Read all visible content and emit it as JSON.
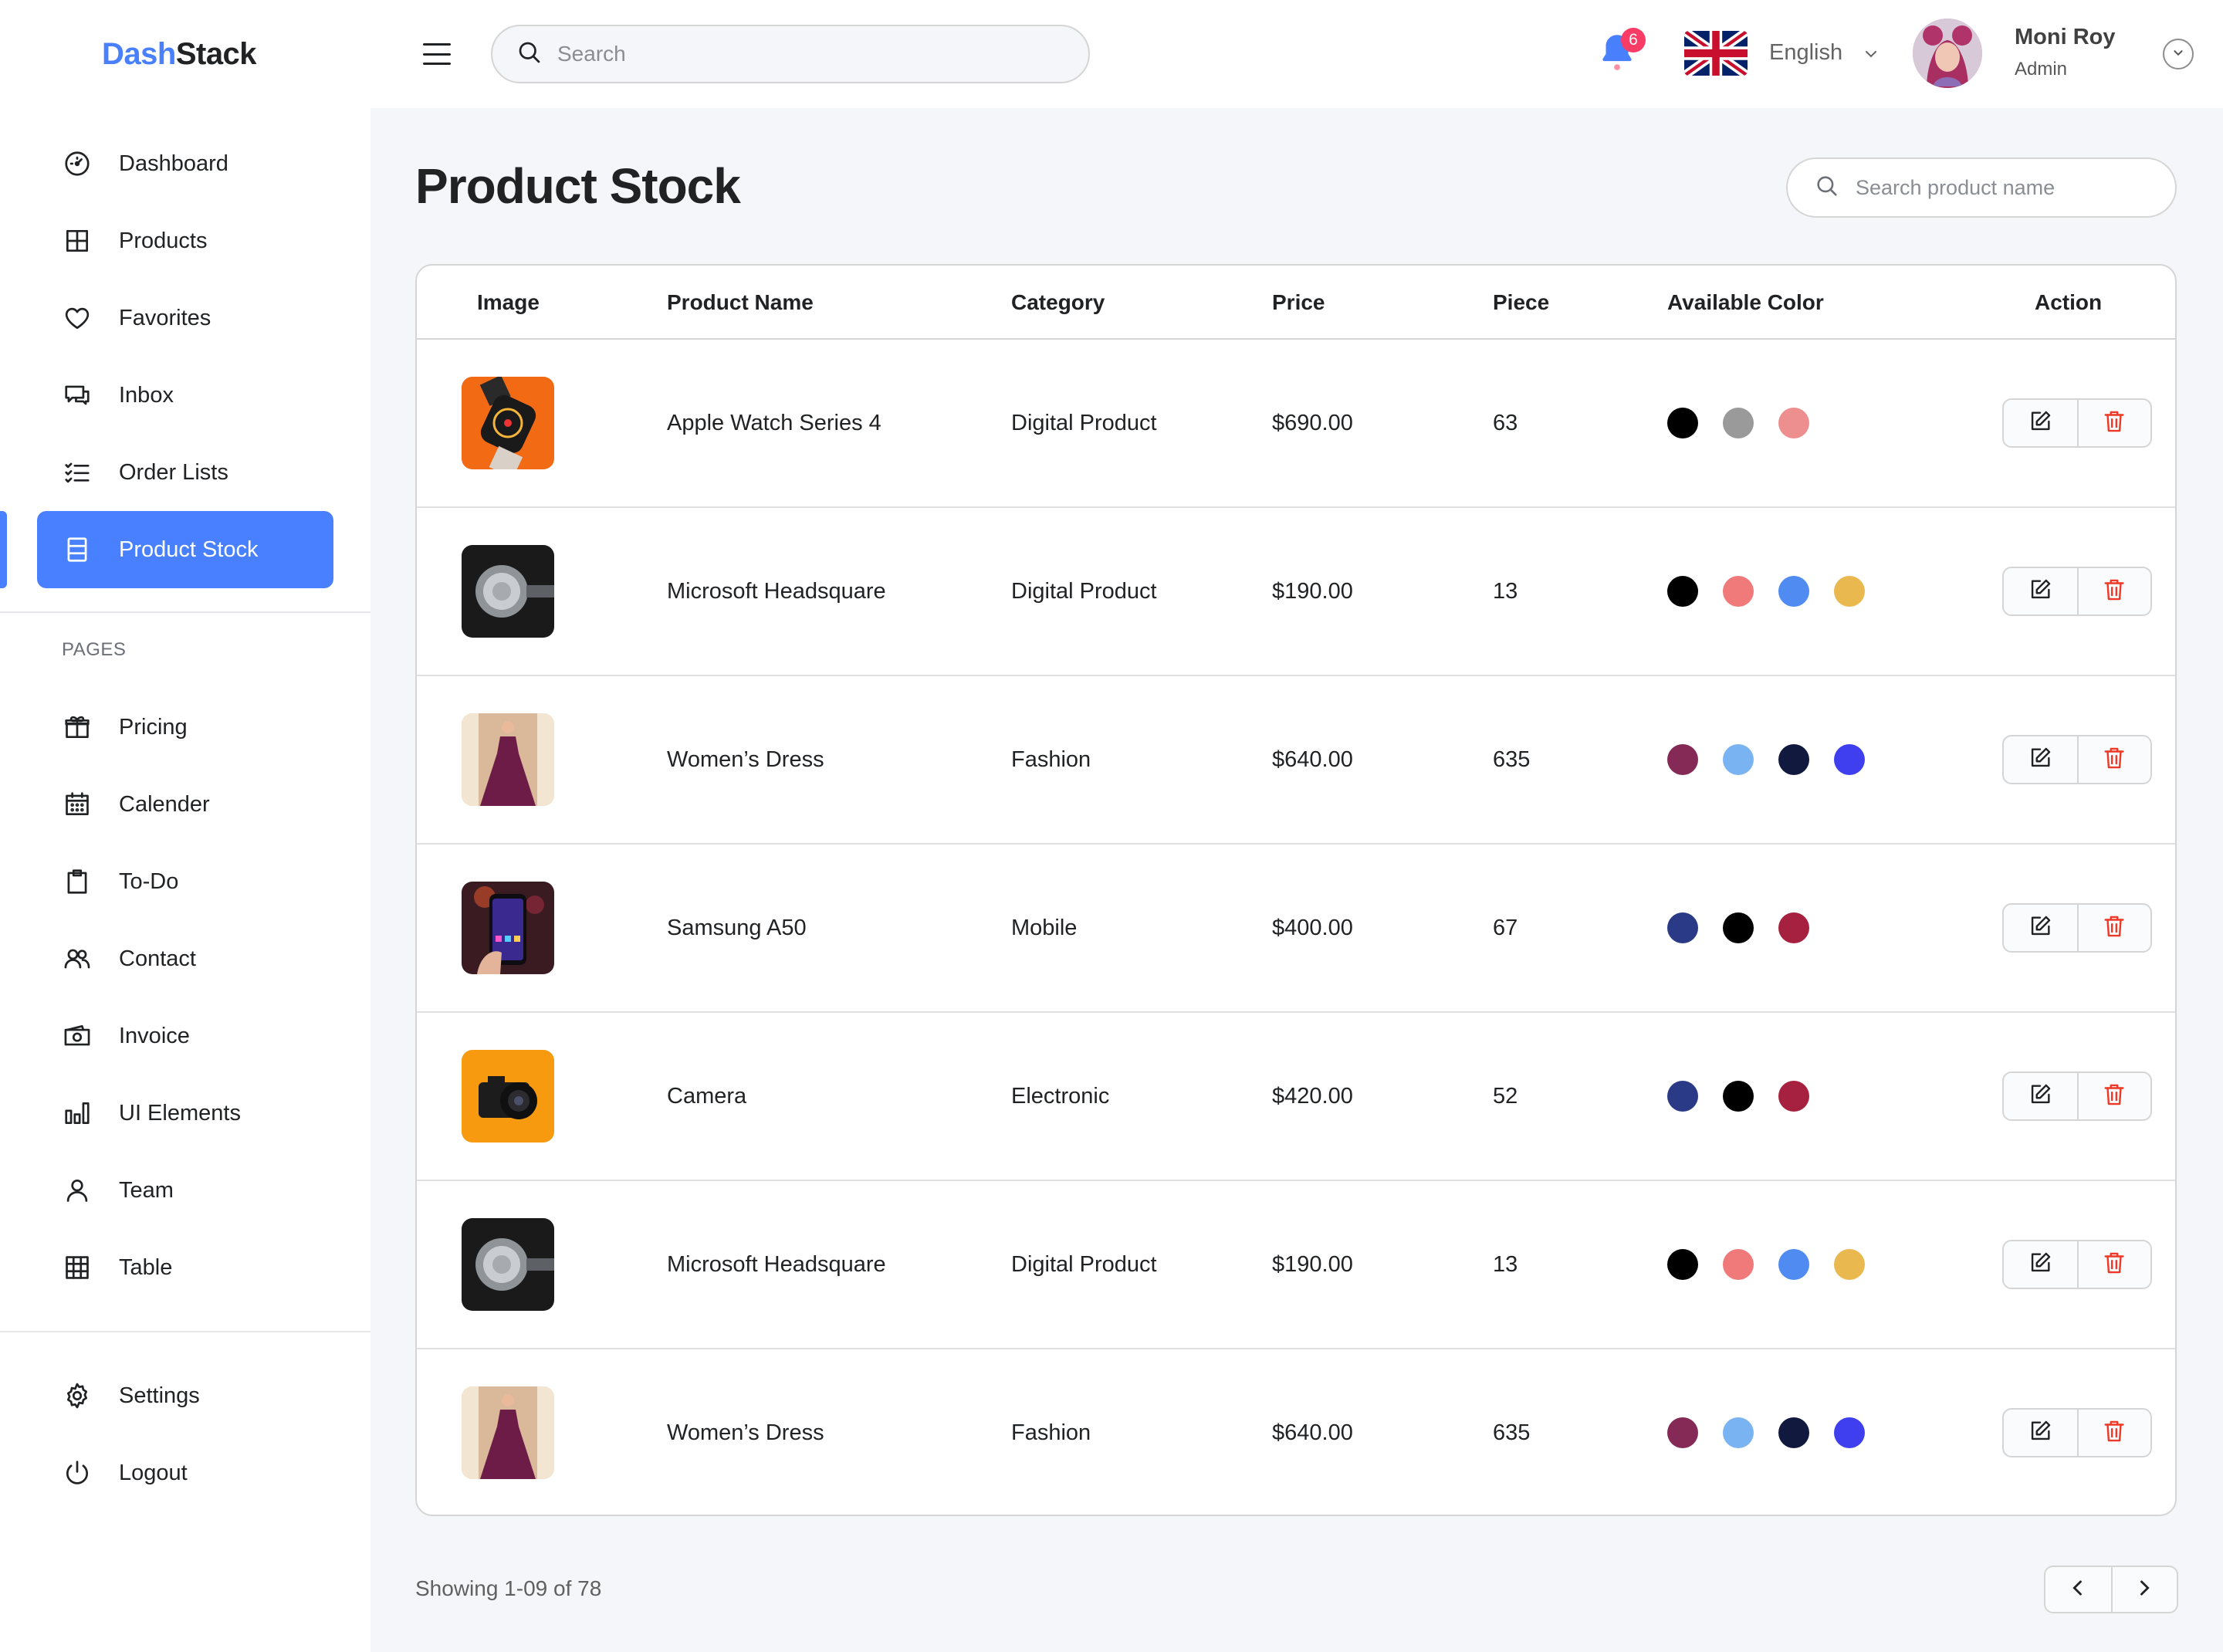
{
  "app": {
    "logo_part1": "Dash",
    "logo_part2": "Stack"
  },
  "sidebar": {
    "main_items": [
      {
        "label": "Dashboard",
        "icon": "speedometer-icon"
      },
      {
        "label": "Products",
        "icon": "grid-icon"
      },
      {
        "label": "Favorites",
        "icon": "heart-icon"
      },
      {
        "label": "Inbox",
        "icon": "chat-icon"
      },
      {
        "label": "Order Lists",
        "icon": "checklist-icon"
      },
      {
        "label": "Product Stock",
        "icon": "stock-icon",
        "active": true
      }
    ],
    "pages_title": "PAGES",
    "page_items": [
      {
        "label": "Pricing",
        "icon": "gift-icon"
      },
      {
        "label": "Calender",
        "icon": "calendar-icon"
      },
      {
        "label": "To-Do",
        "icon": "clipboard-icon"
      },
      {
        "label": "Contact",
        "icon": "users-icon"
      },
      {
        "label": "Invoice",
        "icon": "money-icon"
      },
      {
        "label": "UI Elements",
        "icon": "bar-chart-icon"
      },
      {
        "label": "Team",
        "icon": "user-icon"
      },
      {
        "label": "Table",
        "icon": "table-icon"
      }
    ],
    "bottom_items": [
      {
        "label": "Settings",
        "icon": "gear-icon"
      },
      {
        "label": "Logout",
        "icon": "power-icon"
      }
    ],
    "accent_color": "#4880ff"
  },
  "topbar": {
    "search_placeholder": "Search",
    "notification_count": "6",
    "language": "English",
    "user_name": "Moni Roy",
    "user_role": "Admin"
  },
  "main": {
    "page_title": "Product Stock",
    "search_placeholder": "Search product name",
    "columns": [
      "Image",
      "Product Name",
      "Category",
      "Price",
      "Piece",
      "Available Color",
      "Action"
    ],
    "rows": [
      {
        "name": "Apple Watch Series 4",
        "category": "Digital Product",
        "price": "$690.00",
        "piece": "63",
        "image": "watch",
        "colors": [
          "#000000",
          "#9a9a9a",
          "#ee8f8f"
        ]
      },
      {
        "name": "Microsoft Headsquare",
        "category": "Digital Product",
        "price": "$190.00",
        "piece": "13",
        "image": "headset",
        "colors": [
          "#000000",
          "#f07a7a",
          "#4f8bf0",
          "#e9b84e"
        ]
      },
      {
        "name": "Women’s Dress",
        "category": "Fashion",
        "price": "$640.00",
        "piece": "635",
        "image": "dress",
        "colors": [
          "#852a57",
          "#7ab3f2",
          "#111a3e",
          "#3f3ff0"
        ]
      },
      {
        "name": "Samsung A50",
        "category": "Mobile",
        "price": "$400.00",
        "piece": "67",
        "image": "phone",
        "colors": [
          "#2a3a86",
          "#000000",
          "#a6203f"
        ]
      },
      {
        "name": "Camera",
        "category": "Electronic",
        "price": "$420.00",
        "piece": "52",
        "image": "camera",
        "colors": [
          "#2a3a86",
          "#000000",
          "#a6203f"
        ]
      },
      {
        "name": "Microsoft Headsquare",
        "category": "Digital Product",
        "price": "$190.00",
        "piece": "13",
        "image": "headset",
        "colors": [
          "#000000",
          "#f07a7a",
          "#4f8bf0",
          "#e9b84e"
        ]
      },
      {
        "name": "Women’s Dress",
        "category": "Fashion",
        "price": "$640.00",
        "piece": "635",
        "image": "dress",
        "colors": [
          "#852a57",
          "#7ab3f2",
          "#111a3e",
          "#3f3ff0"
        ]
      }
    ],
    "showing_text": "Showing 1-09 of 78",
    "delete_color": "#ef3826"
  }
}
